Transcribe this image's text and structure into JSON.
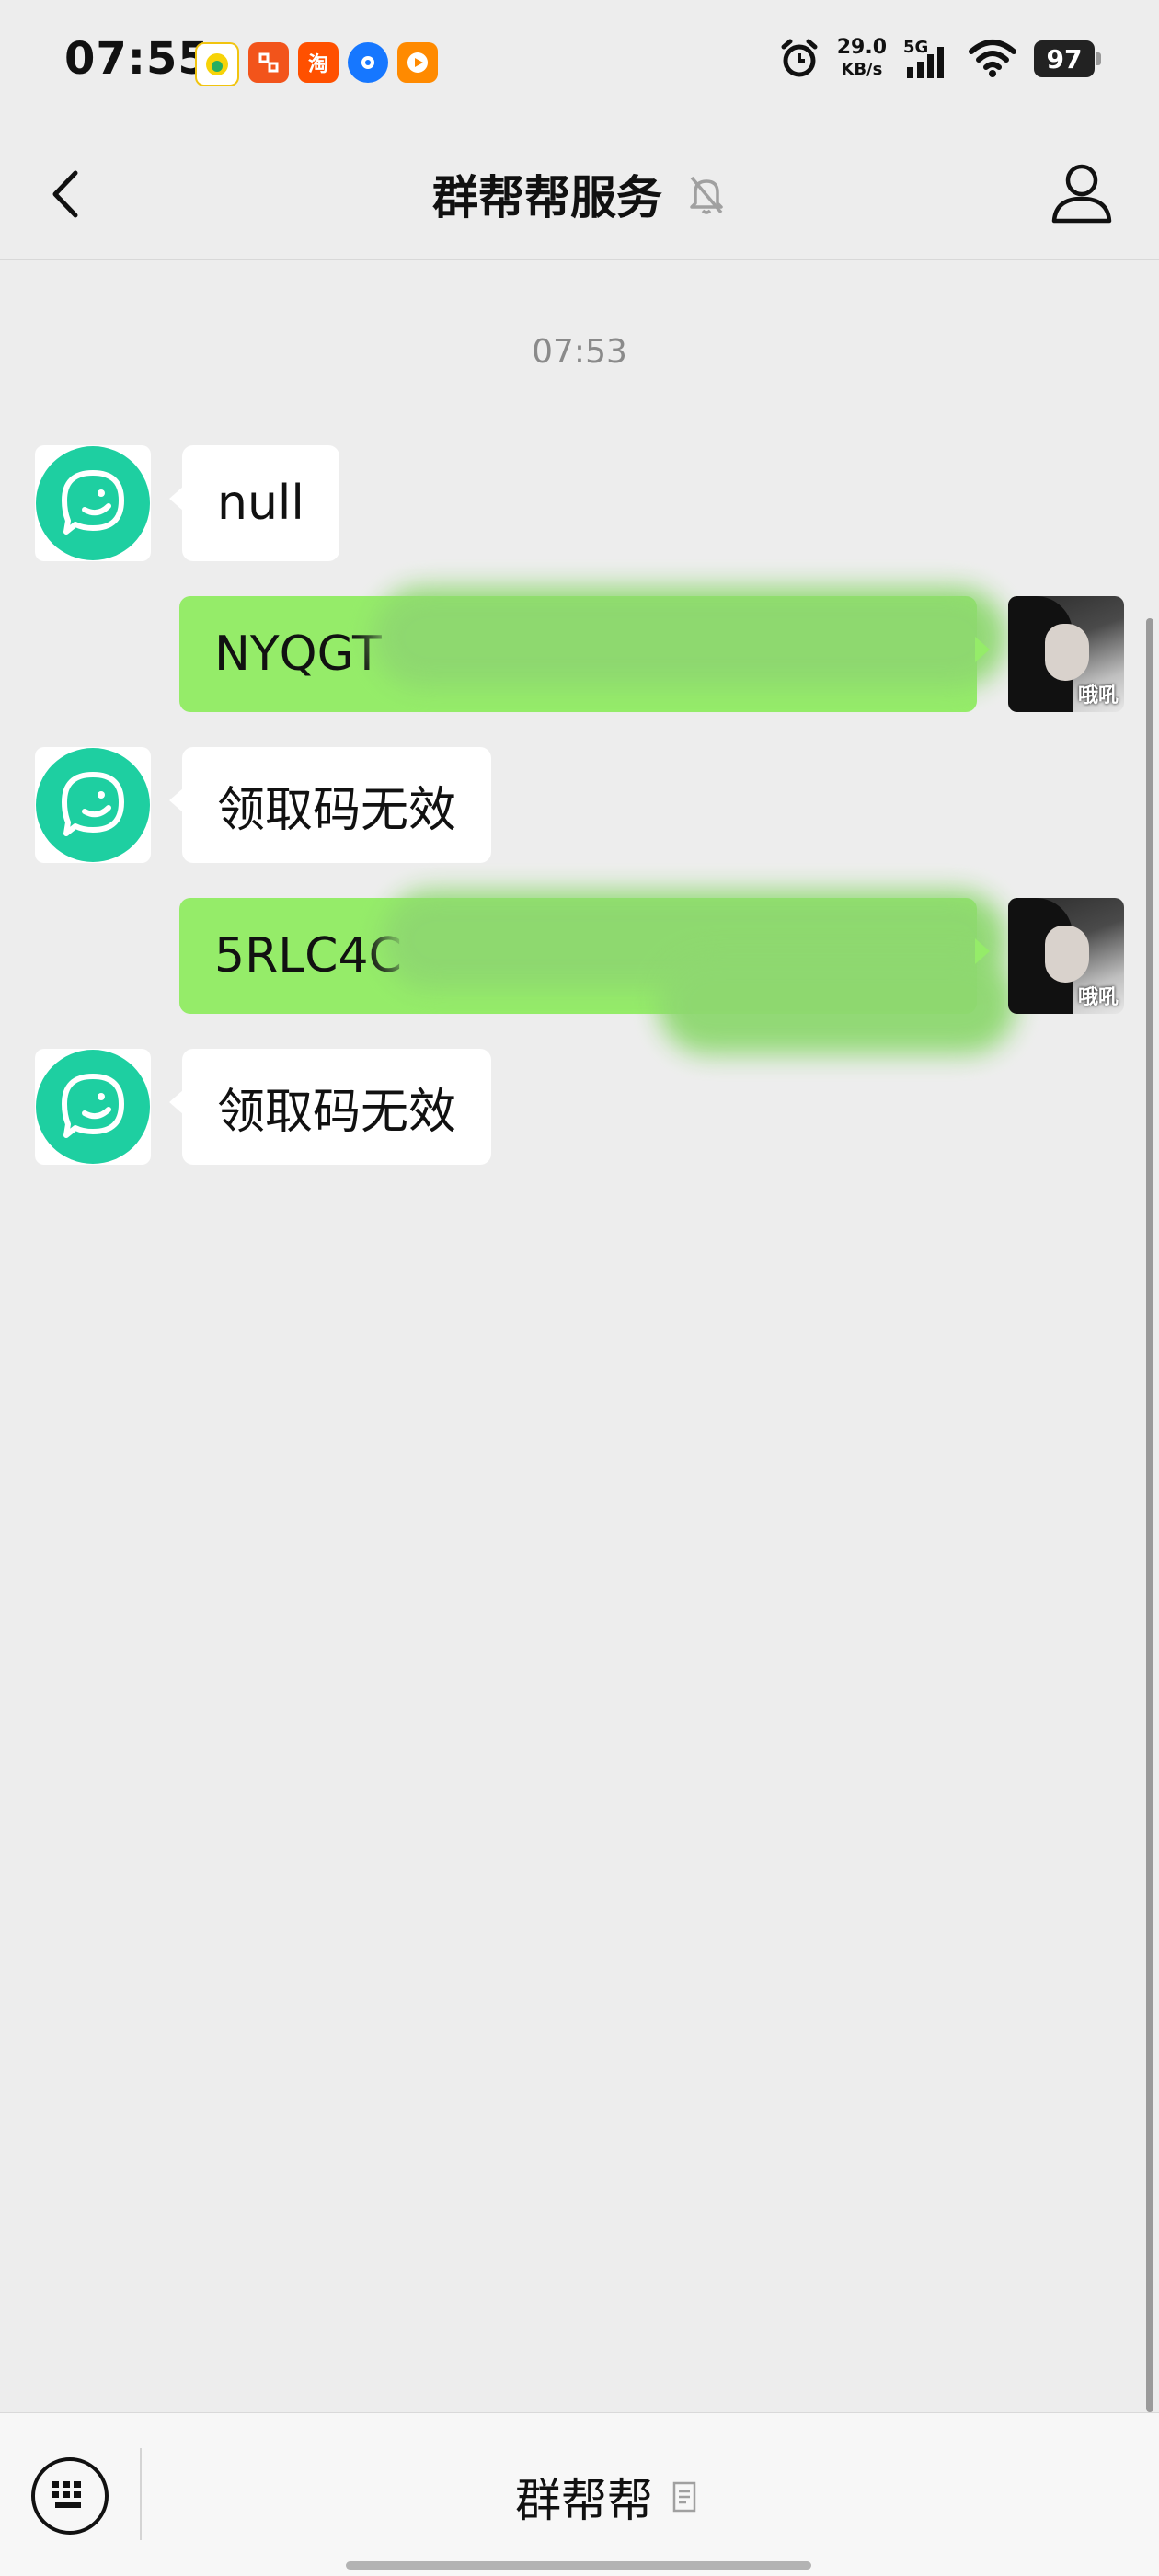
{
  "status_bar": {
    "time": "07:55",
    "notification_icons": [
      "qq-music-icon",
      "pinduoduo-icon",
      "taobao-icon",
      "browser-icon",
      "video-app-icon"
    ],
    "net_speed_value": "29.0",
    "net_speed_unit": "KB/s",
    "network": "5G",
    "battery": "97"
  },
  "header": {
    "title": "群帮帮服务",
    "muted": true
  },
  "chat": {
    "timestamp": "07:53",
    "messages": [
      {
        "from": "bot",
        "text": "null"
      },
      {
        "from": "me",
        "text": "NYQGT",
        "redacted": true
      },
      {
        "from": "bot",
        "text": "领取码无效"
      },
      {
        "from": "me",
        "text": "5RLC4C",
        "redacted": true
      },
      {
        "from": "bot",
        "text": "领取码无效"
      }
    ],
    "user_avatar_caption": "哦吼"
  },
  "bottom_bar": {
    "menu_label": "群帮帮"
  },
  "colors": {
    "background": "#ededed",
    "outgoing_bubble": "#95ec69",
    "incoming_bubble": "#ffffff",
    "bot_avatar": "#1ecfa1",
    "bottom_bar": "#f7f7f7"
  }
}
